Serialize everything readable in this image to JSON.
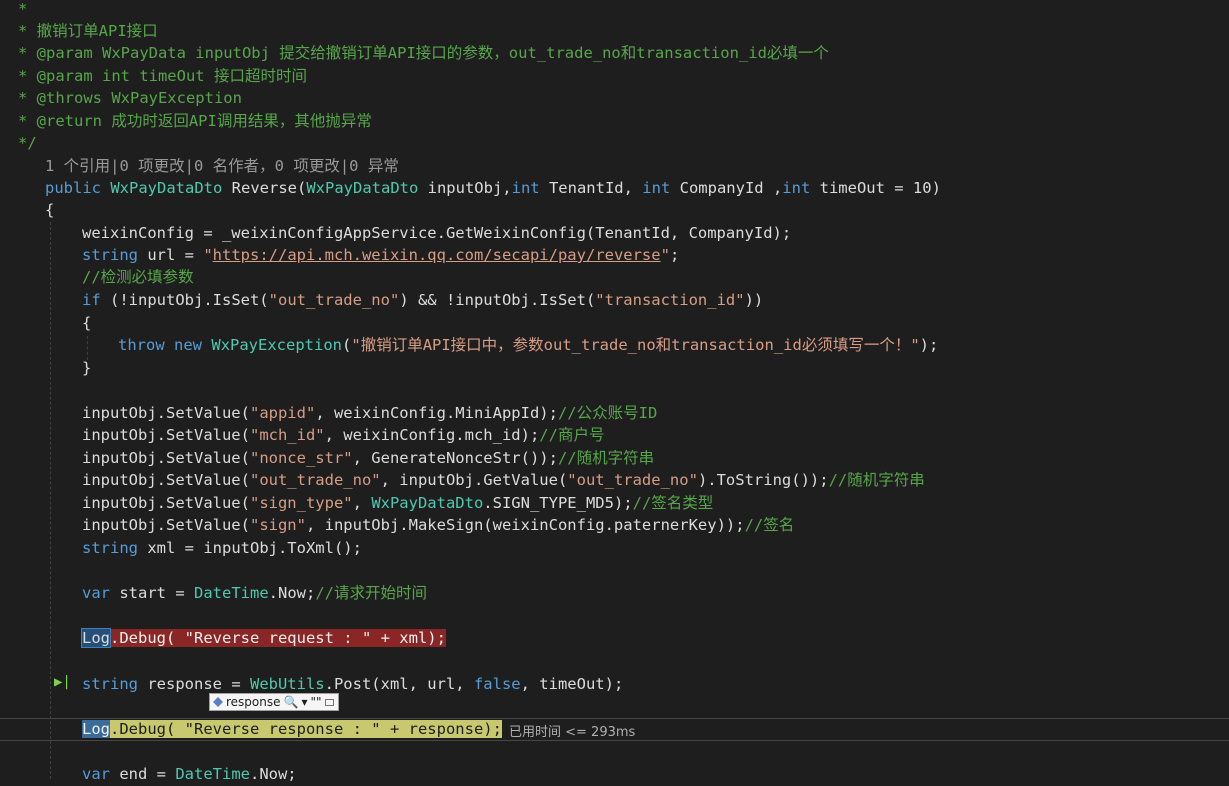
{
  "comment_block": {
    "open": "*",
    "l1_star": "* ",
    "l1": "撤销订单API接口",
    "l2": "* @param WxPayData inputObj 提交给撤销订单API接口的参数，out_trade_no和transaction_id必填一个",
    "l3": "* @param int timeOut 接口超时时间",
    "l4": "* @throws WxPayException",
    "l5": "* @return 成功时返回API调用结果，其他抛异常",
    "close": "*/"
  },
  "codelens": "1 个引用|0 项更改|0 名作者，0 项更改|0 异常",
  "signature": {
    "public": "public",
    "ret_type": "WxPayDataDto",
    "name": " Reverse(",
    "param1_type": "WxPayDataDto",
    "param1": " inputObj,",
    "int1": "int",
    "param2": " TenantId, ",
    "int2": "int",
    "param3": " CompanyId ,",
    "int3": "int",
    "param4": " timeOut = 10)"
  },
  "brace_open": "{",
  "line_config": "weixinConfig = _weixinConfigAppService.GetWeixinConfig(TenantId, CompanyId);",
  "line_url": {
    "kw": "string",
    "mid": " url = ",
    "q1": "\"",
    "url": "https://api.mch.weixin.qq.com/secapi/pay/reverse",
    "q2": "\"",
    "end": ";"
  },
  "comment_check": "//检测必填参数",
  "line_if": {
    "kw": "if",
    "a": " (!inputObj.IsSet(",
    "s1": "\"out_trade_no\"",
    "b": ") && !inputObj.IsSet(",
    "s2": "\"transaction_id\"",
    "c": "))"
  },
  "inner_open": "{",
  "line_throw": {
    "kw1": "throw",
    "kw2": "new",
    "type": "WxPayException",
    "p1": "(",
    "str": "\"撤销订单API接口中，参数out_trade_no和transaction_id必须填写一个！\"",
    "p2": ");"
  },
  "inner_close": "}",
  "setvalue": [
    {
      "a": "inputObj.SetValue(",
      "s": "\"appid\"",
      "b": ", weixinConfig.MiniAppId);",
      "c": "//公众账号ID"
    },
    {
      "a": "inputObj.SetValue(",
      "s": "\"mch_id\"",
      "b": ", weixinConfig.mch_id);",
      "c": "//商户号"
    },
    {
      "a": "inputObj.SetValue(",
      "s": "\"nonce_str\"",
      "b": ", GenerateNonceStr());",
      "c": "//随机字符串"
    }
  ],
  "line_trade": {
    "a": "inputObj.SetValue(",
    "s1": "\"out_trade_no\"",
    "b": ", inputObj.GetValue(",
    "s2": "\"out_trade_no\"",
    "c": ").ToString());",
    "cm": "//随机字符串"
  },
  "line_signtype": {
    "a": "inputObj.SetValue(",
    "s": "\"sign_type\"",
    "b": ", ",
    "type": "WxPayDataDto",
    "c": ".SIGN_TYPE_MD5);",
    "cm": "//签名类型"
  },
  "line_sign": {
    "a": "inputObj.SetValue(",
    "s": "\"sign\"",
    "b": ", inputObj.MakeSign(weixinConfig.paternerKey));",
    "cm": "//签名"
  },
  "line_xml": {
    "kw": "string",
    "rest": " xml = inputObj.ToXml();"
  },
  "line_start": {
    "kw": "var",
    "a": " start = ",
    "type": "DateTime",
    "b": ".Now;",
    "cm": "//请求开始时间"
  },
  "line_log1": {
    "log": "Log",
    "a": ".Debug( ",
    "s": "\"Reverse request : \"",
    "b": " + xml);"
  },
  "line_response": {
    "kw": "string",
    "a": " response = ",
    "type": "WebUtils",
    "b": ".Post(xml, url, ",
    "kw2": "false",
    "c": ", timeOut);"
  },
  "line_log2": {
    "log": "Log",
    "a": ".Debug( ",
    "s": "\"Reverse response : \"",
    "b": " + response);"
  },
  "elapsed": "已用时间 <= 293ms",
  "datatip": {
    "name": "response",
    "search": "🔍",
    "dropdown": "▾",
    "value": "\"\"",
    "pin": ""
  },
  "line_end": {
    "kw": "var",
    "a": " end = ",
    "type": "DateTime",
    "b": ".Now;"
  },
  "run_icon": "▶|"
}
